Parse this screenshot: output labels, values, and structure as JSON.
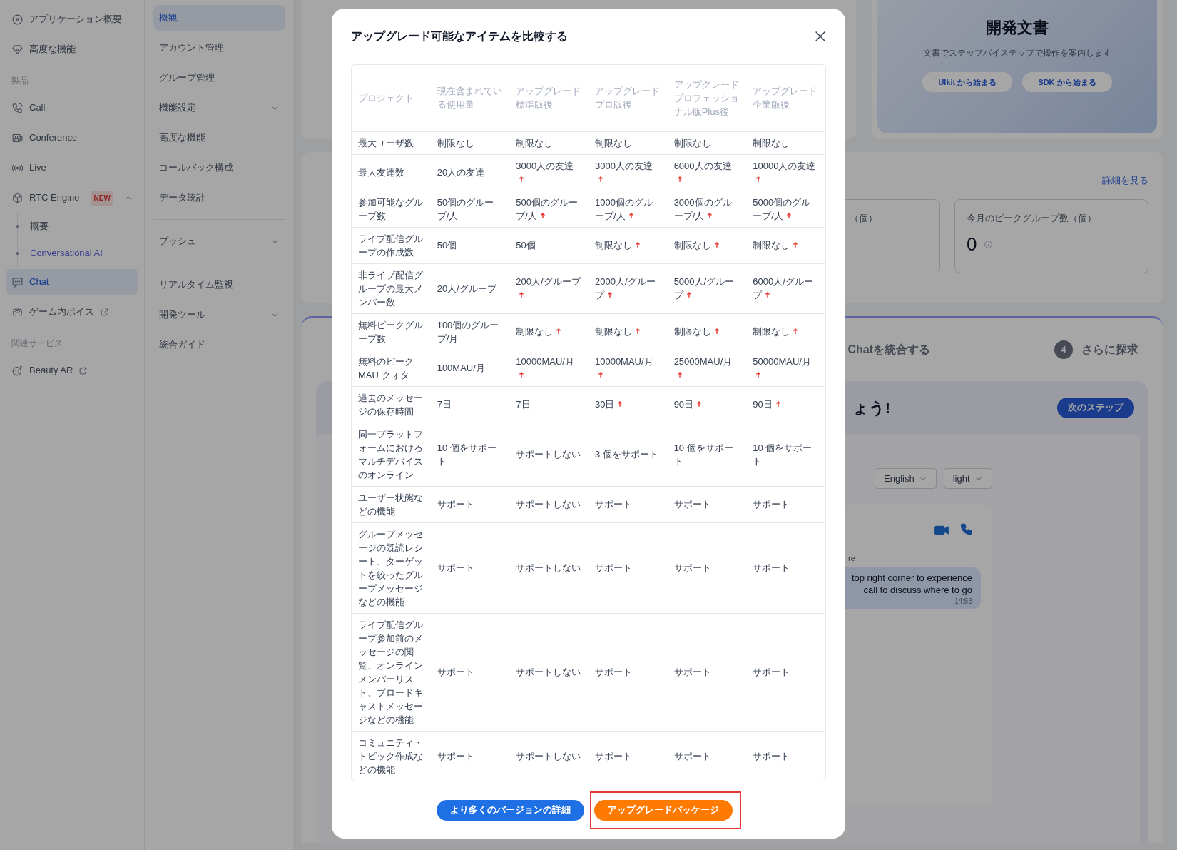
{
  "sidebar": {
    "items": [
      {
        "kind": "item",
        "label": "アプリケーション概要",
        "selected": false
      },
      {
        "kind": "item",
        "label": "高度な機能",
        "selected": false
      },
      {
        "kind": "section",
        "label": "製品"
      },
      {
        "kind": "item",
        "label": "Call",
        "selected": false
      },
      {
        "kind": "item",
        "label": "Conference",
        "selected": false
      },
      {
        "kind": "item",
        "label": "Live",
        "selected": false
      },
      {
        "kind": "item",
        "label": "RTC Engine",
        "badge": "NEW",
        "expanded": true,
        "selected": false,
        "children": [
          {
            "label": "概要",
            "selected": false
          },
          {
            "label": "Conversational AI",
            "selected": true
          }
        ]
      },
      {
        "kind": "item",
        "label": "Chat",
        "selected": true
      },
      {
        "kind": "item",
        "label": "ゲーム内ボイス",
        "external": true,
        "selected": false
      },
      {
        "kind": "section",
        "label": "関連サービス"
      },
      {
        "kind": "item",
        "label": "Beauty AR",
        "external": true,
        "selected": false
      }
    ]
  },
  "subnav": {
    "items": [
      {
        "kind": "item",
        "label": "概観",
        "selected": true,
        "expandable": false
      },
      {
        "kind": "item",
        "label": "アカウント管理",
        "selected": false,
        "expandable": false
      },
      {
        "kind": "item",
        "label": "グループ管理",
        "selected": false,
        "expandable": false
      },
      {
        "kind": "item",
        "label": "機能設定",
        "selected": false,
        "expandable": true
      },
      {
        "kind": "item",
        "label": "高度な機能",
        "selected": false,
        "expandable": false
      },
      {
        "kind": "item",
        "label": "コールバック構成",
        "selected": false,
        "expandable": false
      },
      {
        "kind": "item",
        "label": "データ統計",
        "selected": false,
        "expandable": false
      },
      {
        "kind": "divider"
      },
      {
        "kind": "item",
        "label": "プッシュ",
        "selected": false,
        "expandable": true
      },
      {
        "kind": "divider"
      },
      {
        "kind": "item",
        "label": "リアルタイム監視",
        "selected": false,
        "expandable": false
      },
      {
        "kind": "item",
        "label": "開発ツール",
        "selected": false,
        "expandable": true
      },
      {
        "kind": "item",
        "label": "統合ガイド",
        "selected": false,
        "expandable": false
      }
    ]
  },
  "docs_card": {
    "title": "開発文書",
    "subtitle": "文書でステップバイステップで操作を案内します",
    "buttons": [
      "UIkit から始まる",
      "SDK から始まる"
    ]
  },
  "stats": {
    "link": "詳細を見る",
    "boxes": [
      {
        "label": "（個）"
      },
      {
        "label": "今月のピークグループ数（個）",
        "value": "0"
      }
    ]
  },
  "steps": {
    "items": [
      {
        "label": "Chatを統合する"
      },
      {
        "number": "4",
        "label": "さらに探求"
      }
    ],
    "heading": "ょう!",
    "next_button": "次のステップ",
    "selects": [
      "English",
      "light"
    ],
    "chat": {
      "sender": "re",
      "message": [
        "top right corner to experience",
        "call to discuss where to go"
      ],
      "time": "14:53"
    }
  },
  "modal": {
    "title": "アップグレード可能なアイテムを比較する",
    "columns": [
      "プロジェクト",
      "現在含まれている使用量",
      "アップグレード標準版後",
      "アップグレードプロ版後",
      "アップグレードプロフェッショナル版Plus後",
      "アップグレード企業版後"
    ],
    "rows": [
      {
        "cells": [
          {
            "text": "最大ユーザ数"
          },
          {
            "text": "制限なし",
            "up": false
          },
          {
            "text": "制限なし",
            "up": false
          },
          {
            "text": "制限なし",
            "up": false
          },
          {
            "text": "制限なし",
            "up": false
          },
          {
            "text": "制限なし",
            "up": false
          }
        ]
      },
      {
        "cells": [
          {
            "text": "最大友達数"
          },
          {
            "text": "20人の友達",
            "up": false
          },
          {
            "text": "3000人の友達",
            "up": true
          },
          {
            "text": "3000人の友達",
            "up": true
          },
          {
            "text": "6000人の友達",
            "up": true
          },
          {
            "text": "10000人の友達",
            "up": true
          }
        ]
      },
      {
        "cells": [
          {
            "text": "参加可能なグループ数"
          },
          {
            "text": "50個のグループ/人",
            "up": false
          },
          {
            "text": "500個のグループ/人",
            "up": true
          },
          {
            "text": "1000個のグループ/人",
            "up": true
          },
          {
            "text": "3000個のグループ/人",
            "up": true
          },
          {
            "text": "5000個のグループ/人",
            "up": true
          }
        ]
      },
      {
        "cells": [
          {
            "text": "ライブ配信グループの作成数"
          },
          {
            "text": "50個",
            "up": false
          },
          {
            "text": "50個",
            "up": false
          },
          {
            "text": "制限なし",
            "up": true
          },
          {
            "text": "制限なし",
            "up": true
          },
          {
            "text": "制限なし",
            "up": true
          }
        ]
      },
      {
        "cells": [
          {
            "text": "非ライブ配信グループの最大メンバー数"
          },
          {
            "text": "20人/グループ",
            "up": false
          },
          {
            "text": "200人/グループ",
            "up": true
          },
          {
            "text": "2000人/グループ",
            "up": true
          },
          {
            "text": "5000人/グループ",
            "up": true
          },
          {
            "text": "6000人/グループ",
            "up": true
          }
        ]
      },
      {
        "cells": [
          {
            "text": "無料ピークグループ数"
          },
          {
            "text": "100個のグループ/月",
            "up": false
          },
          {
            "text": "制限なし",
            "up": true
          },
          {
            "text": "制限なし",
            "up": true
          },
          {
            "text": "制限なし",
            "up": true
          },
          {
            "text": "制限なし",
            "up": true
          }
        ]
      },
      {
        "cells": [
          {
            "text": "無料のピークMAU クォタ"
          },
          {
            "text": "100MAU/月",
            "up": false
          },
          {
            "text": "10000MAU/月",
            "up": true
          },
          {
            "text": "10000MAU/月",
            "up": true
          },
          {
            "text": "25000MAU/月",
            "up": true
          },
          {
            "text": "50000MAU/月",
            "up": true
          }
        ]
      },
      {
        "cells": [
          {
            "text": "過去のメッセージの保存時間"
          },
          {
            "text": "7日",
            "up": false
          },
          {
            "text": "7日",
            "up": false
          },
          {
            "text": "30日",
            "up": true
          },
          {
            "text": "90日",
            "up": true
          },
          {
            "text": "90日",
            "up": true
          }
        ]
      },
      {
        "cells": [
          {
            "text": "同一プラットフォームにおけるマルチデバイスのオンライン"
          },
          {
            "text": "10 個をサポート",
            "up": false
          },
          {
            "text": "サポートしない",
            "up": false
          },
          {
            "text": "3 個をサポート",
            "up": false
          },
          {
            "text": "10 個をサポート",
            "up": false
          },
          {
            "text": "10 個をサポート",
            "up": false
          }
        ]
      },
      {
        "cells": [
          {
            "text": "ユーザー状態などの機能"
          },
          {
            "text": "サポート",
            "up": false
          },
          {
            "text": "サポートしない",
            "up": false
          },
          {
            "text": "サポート",
            "up": false
          },
          {
            "text": "サポート",
            "up": false
          },
          {
            "text": "サポート",
            "up": false
          }
        ]
      },
      {
        "cells": [
          {
            "text": "グループメッセージの既読レシート、ターゲットを絞ったグループメッセージなどの機能"
          },
          {
            "text": "サポート",
            "up": false
          },
          {
            "text": "サポートしない",
            "up": false
          },
          {
            "text": "サポート",
            "up": false
          },
          {
            "text": "サポート",
            "up": false
          },
          {
            "text": "サポート",
            "up": false
          }
        ]
      },
      {
        "cells": [
          {
            "text": "ライブ配信グループ参加前のメッセージの閲覧、オンラインメンバーリスト、ブロードキャストメッセージなどの機能"
          },
          {
            "text": "サポート",
            "up": false
          },
          {
            "text": "サポートしない",
            "up": false
          },
          {
            "text": "サポート",
            "up": false
          },
          {
            "text": "サポート",
            "up": false
          },
          {
            "text": "サポート",
            "up": false
          }
        ]
      },
      {
        "cells": [
          {
            "text": "コミュニティ・トピック作成などの機能"
          },
          {
            "text": "サポート",
            "up": false
          },
          {
            "text": "サポートしない",
            "up": false
          },
          {
            "text": "サポート",
            "up": false
          },
          {
            "text": "サポート",
            "up": false
          },
          {
            "text": "サポート",
            "up": false
          }
        ]
      }
    ],
    "buttons": [
      {
        "kind": "secondary",
        "label": "より多くのバージョンの詳細",
        "highlighted": false
      },
      {
        "kind": "primary",
        "label": "アップグレードパッケージ",
        "highlighted": true
      }
    ]
  }
}
